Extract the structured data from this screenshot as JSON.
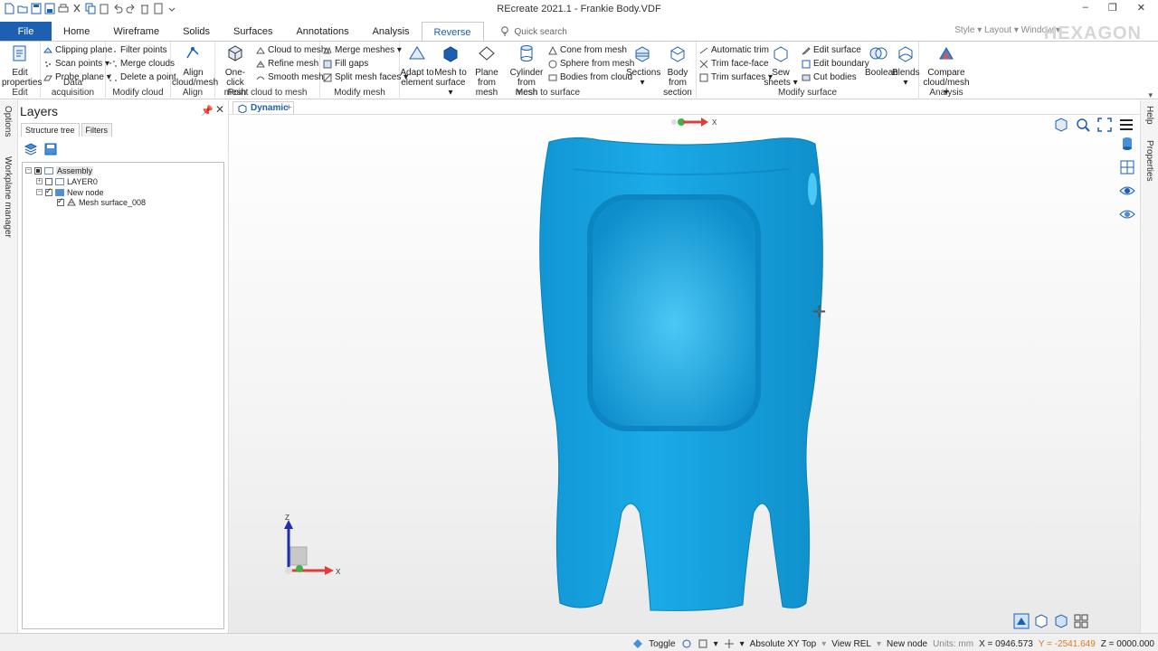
{
  "window": {
    "title": "REcreate 2021.1 - Frankie Body.VDF",
    "controls": [
      "–",
      "❐",
      "✕"
    ],
    "user_area": "Style ▾  Layout ▾  Window ▾",
    "brand": "HEXAGON"
  },
  "tabs": [
    "File",
    "Home",
    "Wireframe",
    "Solids",
    "Surfaces",
    "Annotations",
    "Analysis",
    "Reverse"
  ],
  "active_tab": "Reverse",
  "quick_search": "Quick search",
  "ribbon": {
    "edit": {
      "label": "Edit",
      "edit_properties": "Edit properties"
    },
    "data_acquisition": {
      "label": "Data acquisition",
      "clipping_plane": "Clipping plane",
      "scan_points": "Scan points ▾",
      "probe_plane": "Probe plane ▾"
    },
    "modify_cloud": {
      "label": "Modify cloud",
      "filter_points": "Filter points",
      "merge_clouds": "Merge clouds",
      "delete_point": "Delete a point"
    },
    "align": {
      "label": "Align",
      "align_cloud_mesh": "Align cloud/mesh"
    },
    "point_cloud_to_mesh": {
      "label": "Point cloud to mesh",
      "one_click_mesh": "One-click mesh",
      "cloud_to_mesh": "Cloud to mesh",
      "refine_mesh": "Refine mesh",
      "smooth_mesh": "Smooth mesh"
    },
    "modify_mesh": {
      "label": "Modify mesh",
      "merge_meshes": "Merge meshes ▾",
      "fill_gaps": "Fill gaps",
      "split_mesh_faces": "Split mesh faces ▾"
    },
    "mesh_to_surface": {
      "label": "Mesh to surface",
      "adapt_to_element": "Adapt to element",
      "mesh_to_surface": "Mesh to surface ▾",
      "plane_from_mesh": "Plane from mesh",
      "cylinder_from_mesh": "Cylinder from mesh",
      "cone_from_mesh": "Cone from mesh",
      "sphere_from_mesh": "Sphere from mesh",
      "bodies_from_cloud": "Bodies from cloud",
      "sections": "Sections ▾",
      "body_from_section": "Body from section"
    },
    "modify_surface": {
      "label": "Modify surface",
      "automatic_trim": "Automatic trim",
      "trim_face_face": "Trim face-face",
      "trim_surfaces": "Trim surfaces ▾",
      "sew_sheets": "Sew sheets ▾",
      "edit_surface": "Edit surface",
      "edit_boundary": "Edit boundary",
      "cut_bodies": "Cut bodies",
      "boolean": "Boolean",
      "blends": "Blends ▾"
    },
    "analysis": {
      "label": "Analysis",
      "compare_cloud_mesh": "Compare cloud/mesh ▾"
    }
  },
  "left_strip": {
    "options": "Options",
    "workplane_manager": "Workplane manager"
  },
  "right_strip": {
    "help": "Help",
    "properties": "Properties"
  },
  "layers": {
    "title": "Layers",
    "pin": "📌",
    "close": "✕",
    "tabs": [
      "Structure tree",
      "Filters"
    ],
    "tree": [
      "Assembly",
      "LAYER0",
      "New node",
      "Mesh surface_008"
    ]
  },
  "viewport": {
    "doc_tab": "Dynamic",
    "add_tab": "+",
    "mesh_color": "#17a9e6",
    "axis_labels": {
      "x": "X",
      "z": "Z"
    }
  },
  "status": {
    "toggle": "Toggle",
    "coord_mode": "Absolute XY Top",
    "view": "View REL",
    "node": "New node",
    "units": "Units: mm",
    "x": "X = 0946.573",
    "y": "Y = -2541.649",
    "z": "Z = 0000.000"
  },
  "colors": {
    "accent": "#1d5fb0",
    "mesh": "#17a9e6"
  }
}
